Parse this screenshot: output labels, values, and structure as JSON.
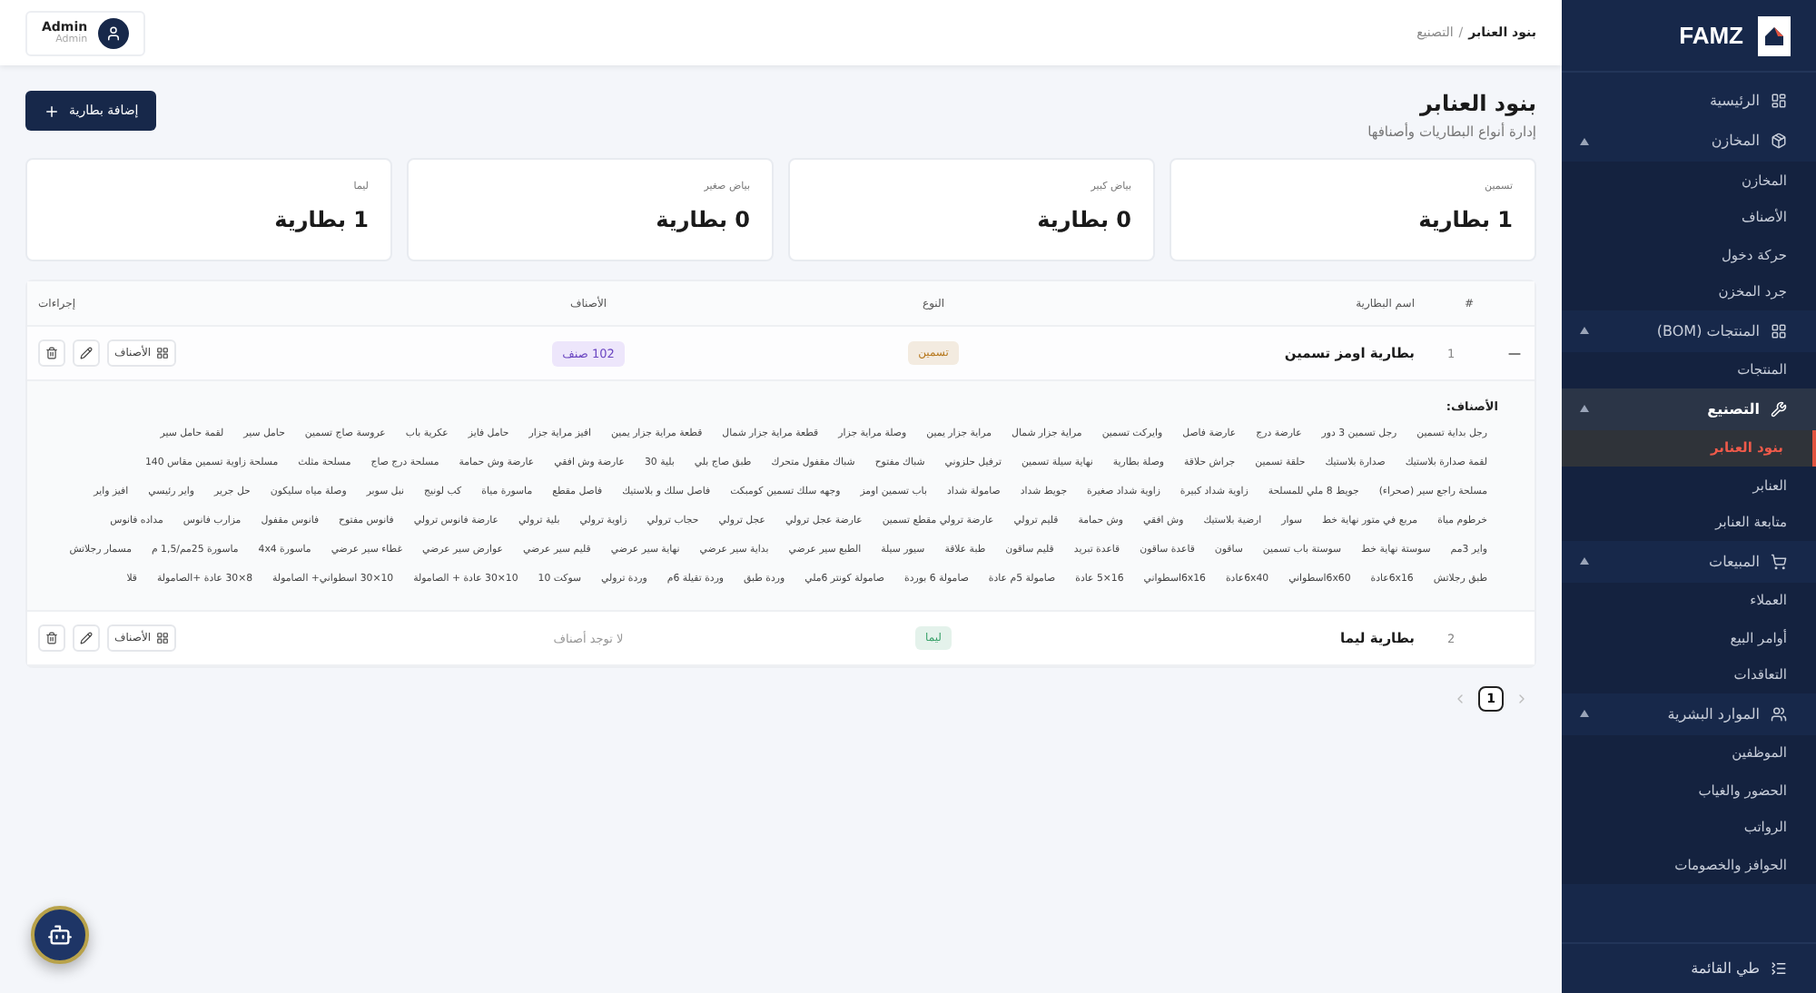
{
  "sidebar": {
    "brand": "FAMZ",
    "items": [
      {
        "label": "الرئيسية",
        "selected": false
      },
      {
        "label": "المخازن",
        "expanded": true,
        "selected": false,
        "children": [
          {
            "label": "المخازن",
            "selected": false
          },
          {
            "label": "الأصناف",
            "selected": false
          },
          {
            "label": "حركة دخول",
            "selected": false
          },
          {
            "label": "جرد المخزن",
            "selected": false
          }
        ]
      },
      {
        "label": "المنتجات (BOM)",
        "expanded": true,
        "selected": false,
        "children": [
          {
            "label": "المنتجات",
            "selected": false
          }
        ]
      },
      {
        "label": "التصنيع",
        "expanded": true,
        "selected": true,
        "children": [
          {
            "label": "بنود العنابر",
            "selected": true
          },
          {
            "label": "العنابر",
            "selected": false
          },
          {
            "label": "متابعة العنابر",
            "selected": false
          }
        ]
      },
      {
        "label": "المبيعات",
        "expanded": true,
        "selected": false,
        "children": [
          {
            "label": "العملاء",
            "selected": false
          },
          {
            "label": "أوامر البيع",
            "selected": false
          },
          {
            "label": "التعاقدات",
            "selected": false
          }
        ]
      },
      {
        "label": "الموارد البشرية",
        "expanded": true,
        "selected": false,
        "children": [
          {
            "label": "الموظفين",
            "selected": false
          },
          {
            "label": "الحضور والغياب",
            "selected": false
          },
          {
            "label": "الرواتب",
            "selected": false
          },
          {
            "label": "الحوافز والخصومات",
            "selected": false
          }
        ]
      }
    ],
    "collapse": "طي القائمة"
  },
  "header": {
    "breadcrumb_parent": "التصنيع",
    "breadcrumb_separator": "/",
    "breadcrumb_current": "بنود العنابر",
    "user_name": "Admin",
    "user_role": "Admin"
  },
  "page": {
    "title": "بنود العنابر",
    "subtitle": "إدارة أنواع البطاريات وأصنافها",
    "add_button": "إضافة بطارية"
  },
  "stats": [
    {
      "label": "تسمين",
      "value": "1 بطارية"
    },
    {
      "label": "بياض كبير",
      "value": "0 بطارية"
    },
    {
      "label": "بياض صغير",
      "value": "0 بطارية"
    },
    {
      "label": "ليما",
      "value": "1 بطارية"
    }
  ],
  "table": {
    "columns": [
      "#",
      "اسم البطارية",
      "النوع",
      "الأصناف",
      "إجراءات"
    ],
    "rows": [
      {
        "number": "1",
        "name": "بطارية اومز تسمين",
        "type": {
          "text": "تسمين",
          "color": "#b7791f"
        },
        "items_count": "102 صنف",
        "items_button": "الأصناف",
        "expanded": true,
        "items_title": "الأصناف:",
        "items": [
          "رجل بداية تسمين",
          "رجل تسمين 3 دور",
          "عارضة درج",
          "عارضة فاصل",
          "وايركت تسمين",
          "مراية جزار شمال",
          "مراية جزار يمين",
          "وصلة مراية جزار",
          "قطعة مراية جزار شمال",
          "قطعة مراية جزار يمين",
          "افيز مراية جزار",
          "حامل فايز",
          "عكرية باب",
          "عروسة صاج تسمين",
          "حامل سير",
          "لقمة حامل سير",
          "لقمة صدارة بلاستيك",
          "صدارة بلاستيك",
          "حلقة تسمين",
          "جراش حلاقة",
          "وصلة بطارية",
          "نهاية سيلة تسمين",
          "ترفيل حلزوني",
          "شباك مفتوح",
          "شباك مقفول متحرك",
          "طبق صاج بلي",
          "بلية 30",
          "عارضة وش افقي",
          "عارضة وش حمامة",
          "مسلحة درج صاج",
          "مسلحة مثلث",
          "مسلحة زاوية تسمين مقاس 140",
          "مسلحة راجع سير (صحراء)",
          "جويط 8 ملي للمسلحة",
          "زاوية شداد كبيرة",
          "زاوية شداد صغيرة",
          "جويط شداد",
          "صامولة شداد",
          "باب تسمين اومز",
          "وجهه سلك تسمين كومبكت",
          "فاصل سلك و بلاستيك",
          "فاصل مقطع",
          "ماسورة مياة",
          "كب لونيج",
          "نبل سوبر",
          "وصلة مياه سليكون",
          "حل جرير",
          "واير رئيسي",
          "افيز واير",
          "خرطوم مياة",
          "مربع في متور نهاية خط",
          "سوار",
          "ارضية بلاستيك",
          "وش افقي",
          "وش حمامة",
          "قليم ترولي",
          "عارضة ترولي مقطع تسمين",
          "عارضة عجل ترولي",
          "عجل ترولي",
          "حجاب ترولي",
          "زاوية ترولي",
          "بلية ترولي",
          "عارضة فانوس ترولي",
          "فانوس مفتوح",
          "فانوس مقفول",
          "مزارب فانوس",
          "مداده فانوس",
          "واير 3مم",
          "سوستة نهاية خط",
          "سوستة باب تسمين",
          "ساقون",
          "قاعدة ساقون",
          "قاعدة تبريد",
          "قليم ساقون",
          "طبة علاقة",
          "سيور سيلة",
          "الطبع سير عرضي",
          "بداية سير عرضي",
          "نهاية سير عرضي",
          "قليم سير عرضي",
          "عوارض سير عرضي",
          "غطاء سير عرضي",
          "ماسورة 4x4",
          "ماسورة 25مم/1,5 م",
          "مسمار رجلاتش",
          "طبق رجلاتش",
          "6x16عادة",
          "6x60اسطواني",
          "6x40عادة",
          "6x16اسطواني",
          "16×5 عادة",
          "صامولة 5م عادة",
          "صامولة 6 بوردة",
          "صامولة كونتر 6ملي",
          "وردة طبق",
          "وردة تقيلة 6م",
          "وردة ترولي",
          "سوكت 10",
          "10×30 عادة + الصامولة",
          "10×30 اسطواني+ الصامولة",
          "8×30 عادة +الصامولة",
          "قلا"
        ]
      },
      {
        "number": "2",
        "name": "بطارية ليما",
        "type": {
          "text": "ليما",
          "color": "#38a169"
        },
        "items_count": "لا توجد أصناف",
        "items_button": "الأصناف",
        "items": []
      }
    ]
  },
  "pagination": {
    "pages": [
      {
        "label": "1",
        "selected": true
      }
    ]
  }
}
